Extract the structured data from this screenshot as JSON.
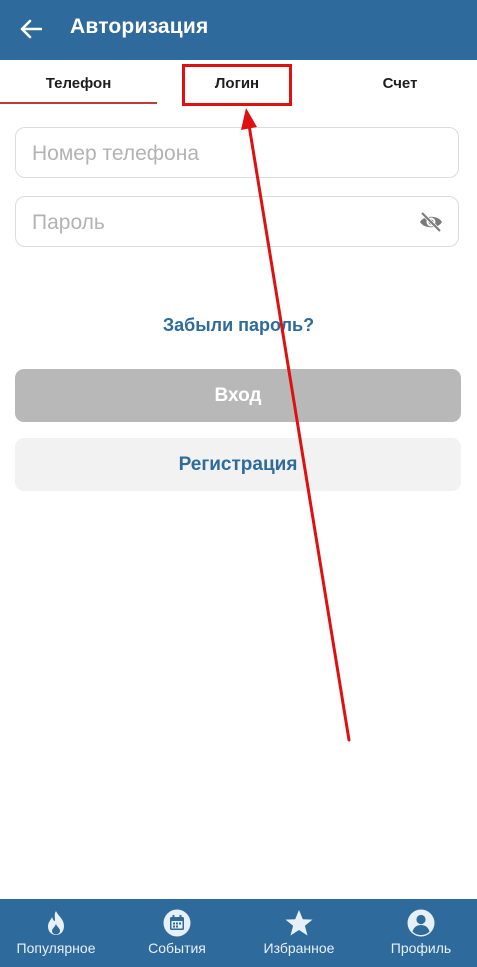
{
  "app_bar": {
    "title": "Авторизация",
    "back_icon": "arrow-left-icon",
    "background": "#2f6a9c"
  },
  "tabs": [
    {
      "label": "Телефон",
      "selected": true
    },
    {
      "label": "Логин",
      "selected": false
    },
    {
      "label": "Счет",
      "selected": false
    }
  ],
  "form": {
    "phone": {
      "placeholder": "Номер телефона",
      "value": ""
    },
    "password": {
      "placeholder": "Пароль",
      "value": "",
      "toggle_icon": "eye-off-icon"
    },
    "forgot_link": "Забыли пароль?",
    "login_button": "Вход",
    "register_button": "Регистрация"
  },
  "colors": {
    "accent": "#2f6a9c",
    "tab_indicator": "#c23a3a",
    "annotation": "#e11010",
    "disabled_button": "#b8b8b8"
  },
  "bottom_nav": [
    {
      "label": "Популярное",
      "icon": "flame-icon"
    },
    {
      "label": "События",
      "icon": "calendar-icon"
    },
    {
      "label": "Избранное",
      "icon": "star-icon"
    },
    {
      "label": "Профиль",
      "icon": "user-icon"
    }
  ]
}
